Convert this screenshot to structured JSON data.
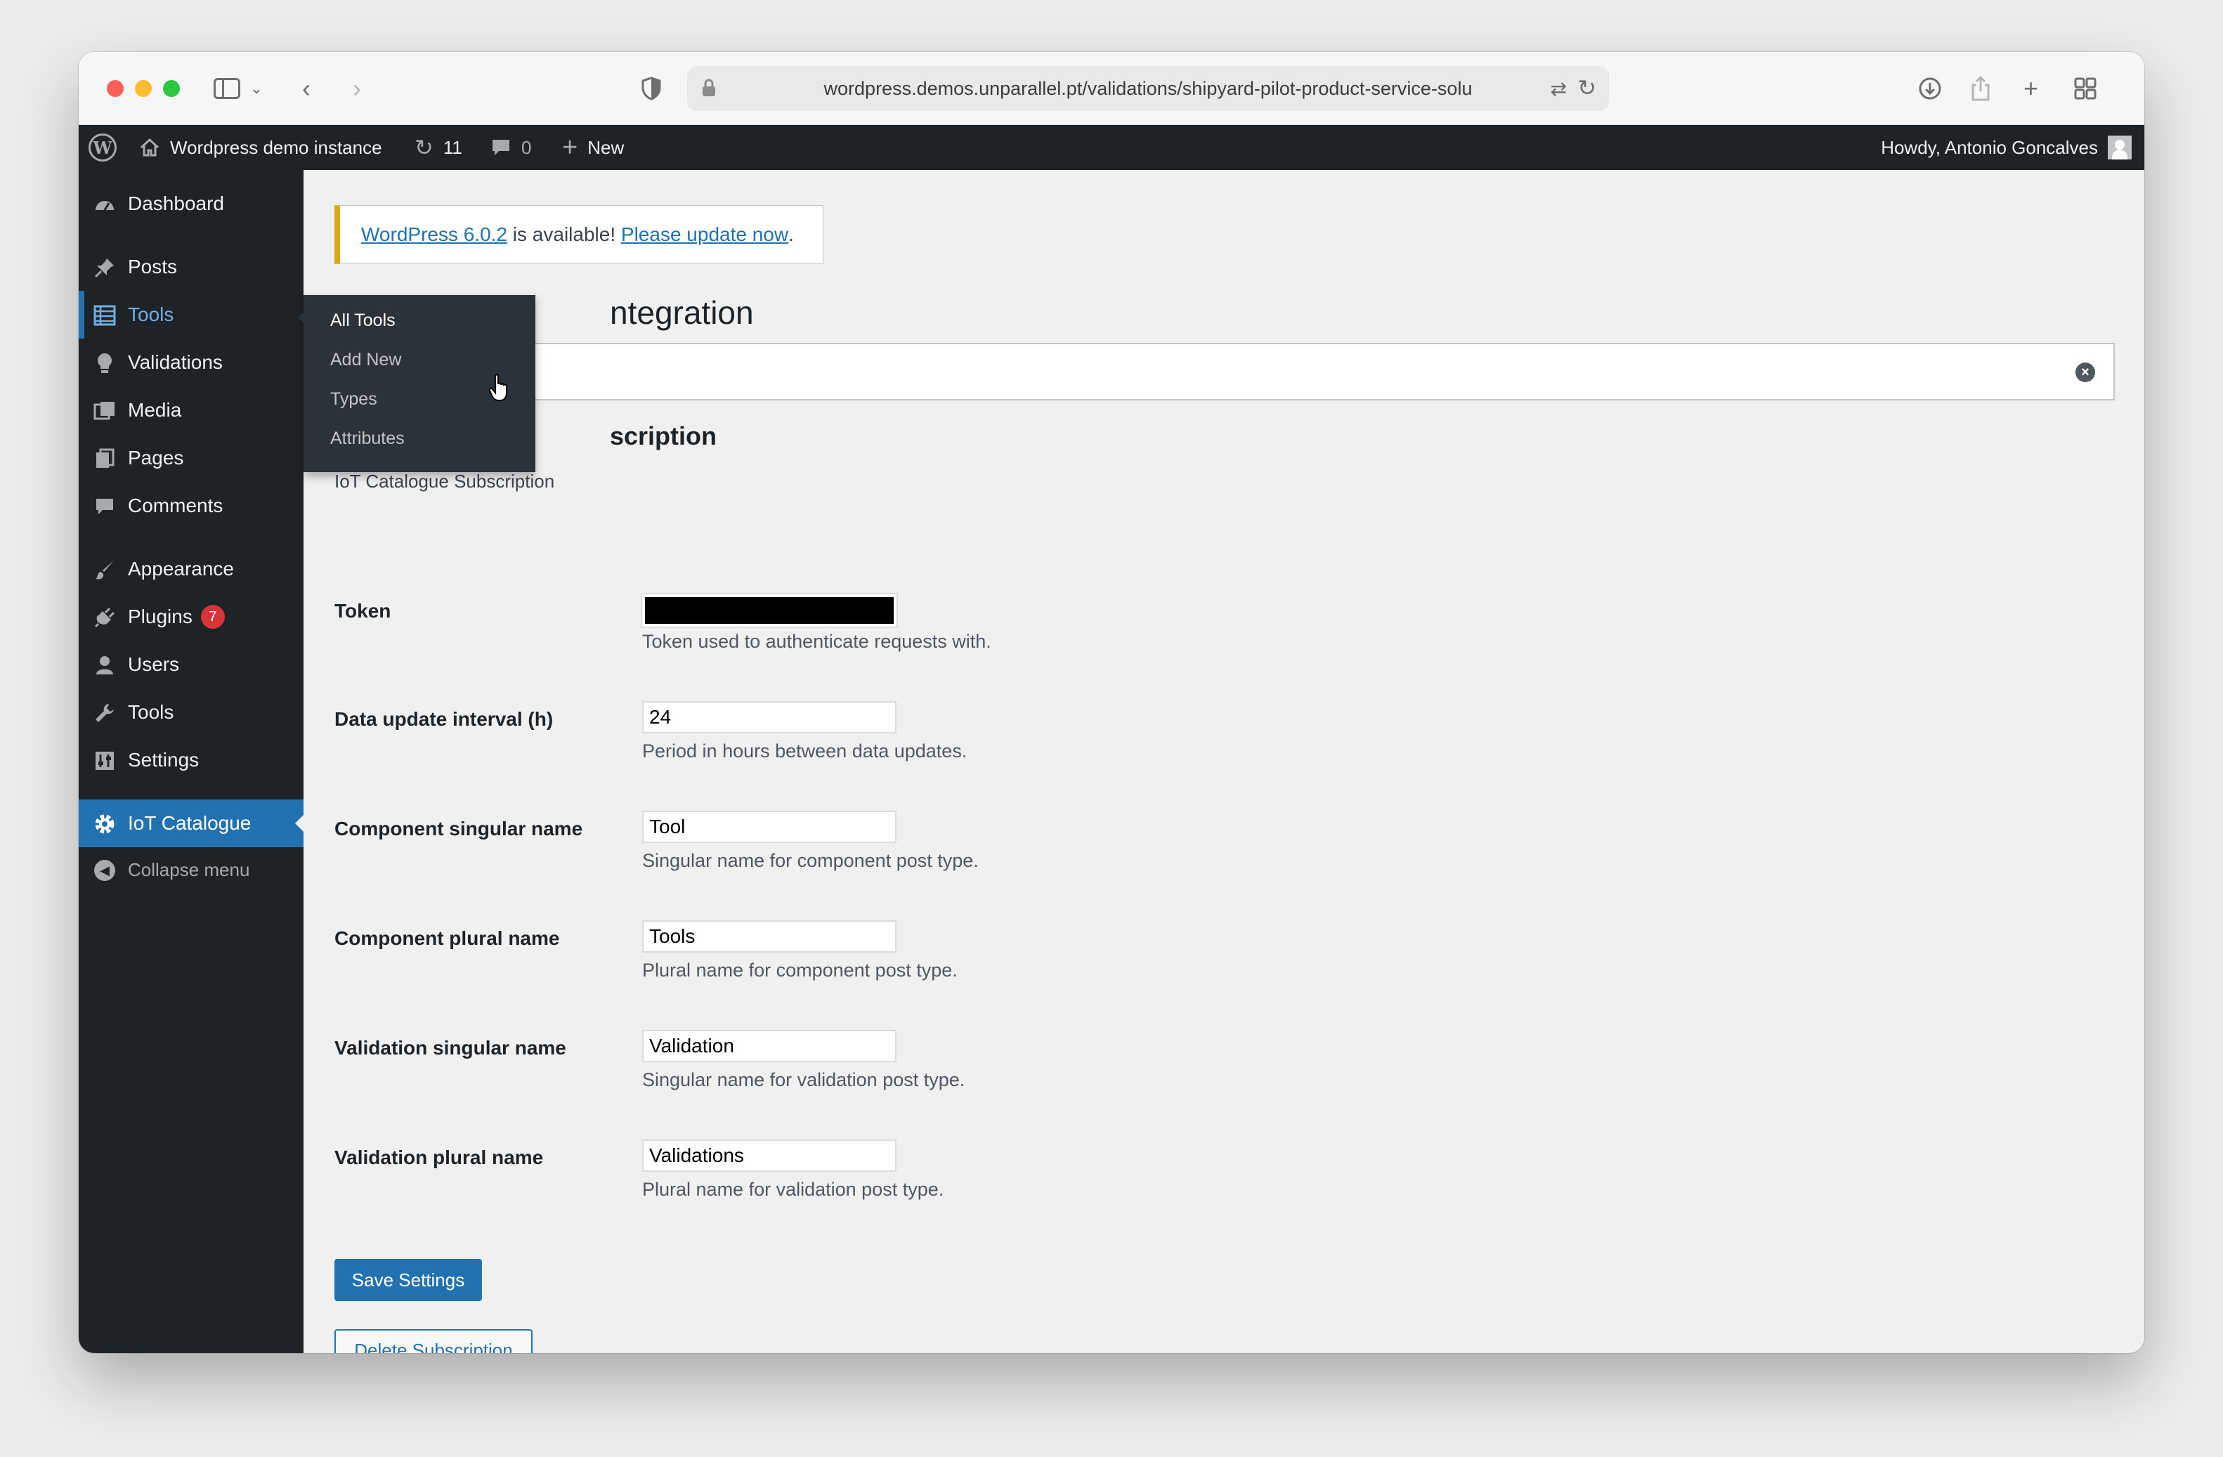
{
  "browser": {
    "url": "wordpress.demos.unparallel.pt/validations/shipyard-pilot-product-service-solu"
  },
  "adminbar": {
    "site_name": "Wordpress demo instance",
    "updates_count": "11",
    "comments_count": "0",
    "new_label": "New",
    "greeting": "Howdy, Antonio Goncalves"
  },
  "menu": {
    "items": [
      {
        "label": "Dashboard",
        "icon": "dashboard-icon"
      },
      {
        "label": "Posts",
        "icon": "pin-icon"
      },
      {
        "label": "Tools",
        "icon": "list-icon"
      },
      {
        "label": "Validations",
        "icon": "lightbulb-icon"
      },
      {
        "label": "Media",
        "icon": "media-icon"
      },
      {
        "label": "Pages",
        "icon": "page-icon"
      },
      {
        "label": "Comments",
        "icon": "comment-icon"
      },
      {
        "label": "Appearance",
        "icon": "brush-icon"
      },
      {
        "label": "Plugins",
        "icon": "plugin-icon",
        "badge": "7"
      },
      {
        "label": "Users",
        "icon": "user-icon"
      },
      {
        "label": "Tools",
        "icon": "wrench-icon"
      },
      {
        "label": "Settings",
        "icon": "settings-icon"
      },
      {
        "label": "IoT Catalogue",
        "icon": "gear-icon"
      }
    ],
    "collapse_label": "Collapse menu"
  },
  "flyout": {
    "items": [
      "All Tools",
      "Add New",
      "Types",
      "Attributes"
    ]
  },
  "notice": {
    "version_link": "WordPress 6.0.2",
    "middle_text": " is available! ",
    "update_link": "Please update now",
    "end_text": "."
  },
  "page": {
    "title_visible": "ntegration",
    "section_heading_visible": "scription",
    "section_description": "IoT Catalogue Subscription"
  },
  "fields": [
    {
      "label": "Token",
      "value": "",
      "help": "Token used to authenticate requests with."
    },
    {
      "label": "Data update interval (h)",
      "value": "24",
      "help": "Period in hours between data updates."
    },
    {
      "label": "Component singular name",
      "value": "Tool",
      "help": "Singular name for component post type."
    },
    {
      "label": "Component plural name",
      "value": "Tools",
      "help": "Plural name for component post type."
    },
    {
      "label": "Validation singular name",
      "value": "Validation",
      "help": "Singular name for validation post type."
    },
    {
      "label": "Validation plural name",
      "value": "Validations",
      "help": "Plural name for validation post type."
    }
  ],
  "buttons": {
    "save": "Save Settings",
    "delete": "Delete Subscription"
  },
  "colors": {
    "accent": "#2271b1",
    "menu_bg": "#1d2327",
    "notice_border": "#dba617",
    "badge": "#d63638"
  }
}
